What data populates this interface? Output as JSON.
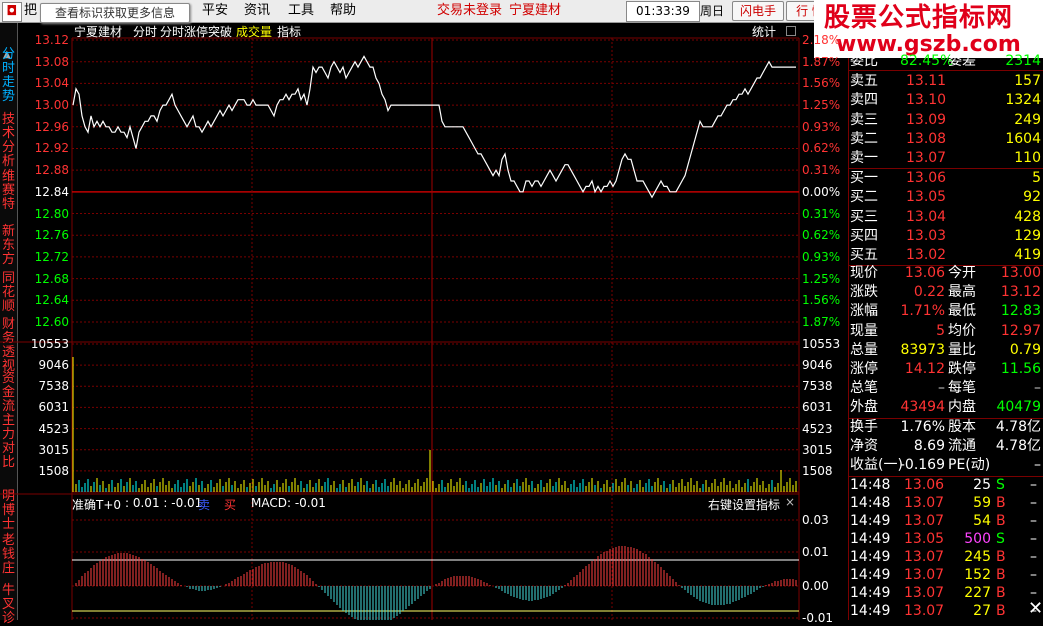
{
  "menubar": {
    "tip": "查看标识获取更多信息",
    "left_glyph": "把",
    "items": [
      "平安",
      "资讯",
      "工具",
      "帮助"
    ],
    "login_status": "交易未登录",
    "stock_name": "宁夏建材",
    "time": "01:33:39",
    "weekday": "周日",
    "flash_btn": "闪电手",
    "quote_btn": "行  情",
    "watermark": "股票公式指标网",
    "watermark_url": "www.gszb.com"
  },
  "sidebar": {
    "tabs": [
      "分时走势",
      "技术分析",
      "维赛特",
      "新东方",
      "同花顺",
      "财务透视",
      "资金流",
      "主力对比",
      "明博士",
      "老钱庄",
      "牛叉诊"
    ]
  },
  "chart_header": {
    "items": [
      "宁夏建材",
      "分时",
      "分时涨停突破",
      "成交量",
      "指标"
    ],
    "stats": "统计"
  },
  "macd_header": {
    "name": "准确T+0",
    "values": ": 0.01 : -0.01",
    "sell": "卖",
    "buy": "买",
    "macd": "MACD: -0.01",
    "right_text": "右键设置指标",
    "close": "×"
  },
  "chart_data": {
    "type": "line",
    "price_ticks_left": [
      "13.12",
      "13.08",
      "13.04",
      "13.00",
      "12.96",
      "12.92",
      "12.88",
      "12.84",
      "12.80",
      "12.76",
      "12.72",
      "12.68",
      "12.64",
      "12.60"
    ],
    "pct_ticks_right": [
      "2.18%",
      "1.87%",
      "1.56%",
      "1.25%",
      "0.93%",
      "0.62%",
      "0.31%",
      "0.00%",
      "0.31%",
      "0.62%",
      "0.93%",
      "1.25%",
      "1.56%",
      "1.87%"
    ],
    "volume_ticks": [
      "10553",
      "9046",
      "7538",
      "6031",
      "4523",
      "3015",
      "1508"
    ],
    "macd_ticks": [
      "0.03",
      "0.01",
      "0.00",
      "-0.01"
    ],
    "ylim": [
      12.58,
      13.14
    ],
    "prev_close": 12.84,
    "price_series": [
      13.0,
      13.03,
      13.02,
      12.98,
      12.96,
      12.95,
      12.98,
      12.96,
      12.97,
      12.96,
      12.97,
      12.96,
      12.96,
      12.95,
      12.95,
      12.96,
      12.95,
      12.95,
      12.94,
      12.96,
      12.94,
      12.92,
      12.95,
      12.96,
      12.97,
      12.97,
      12.98,
      12.98,
      12.97,
      12.99,
      13.0,
      13.0,
      13.01,
      13.02,
      13.0,
      12.99,
      12.98,
      12.97,
      12.96,
      12.97,
      12.98,
      12.96,
      12.96,
      12.95,
      12.96,
      12.97,
      12.96,
      12.97,
      12.98,
      12.99,
      12.98,
      12.99,
      13.0,
      12.99,
      13.0,
      13.01,
      13.01,
      13.01,
      13.0,
      13.0,
      13.01,
      13.0,
      13.0,
      13.0,
      13.0,
      13.0,
      12.99,
      12.98,
      13.0,
      13.01,
      13.01,
      13.02,
      13.01,
      13.02,
      13.02,
      13.03,
      13.01,
      13.02,
      13.0,
      13.03,
      13.07,
      13.06,
      13.07,
      13.07,
      13.06,
      13.05,
      13.07,
      13.08,
      13.07,
      13.06,
      13.07,
      13.05,
      13.06,
      13.07,
      13.08,
      13.07,
      13.08,
      13.09,
      13.08,
      13.07,
      13.07,
      13.05,
      13.04,
      13.02,
      13.01,
      12.99,
      13.0,
      13.0,
      13.0,
      13.0,
      13.0,
      13.0,
      13.0,
      13.0,
      13.0,
      13.0,
      13.0,
      13.0,
      13.0,
      13.0,
      13.0,
      13.0,
      13.0,
      12.97,
      12.96,
      12.96,
      12.96,
      12.96,
      12.96,
      12.96,
      12.96,
      12.95,
      12.94,
      12.93,
      12.92,
      12.91,
      12.91,
      12.9,
      12.89,
      12.88,
      12.87,
      12.88,
      12.87,
      12.9,
      12.91,
      12.88,
      12.86,
      12.86,
      12.85,
      12.84,
      12.84,
      12.86,
      12.86,
      12.85,
      12.86,
      12.86,
      12.85,
      12.86,
      12.87,
      12.88,
      12.87,
      12.86,
      12.87,
      12.88,
      12.89,
      12.89,
      12.88,
      12.87,
      12.86,
      12.85,
      12.84,
      12.85,
      12.85,
      12.86,
      12.84,
      12.85,
      12.84,
      12.85,
      12.85,
      12.86,
      12.85,
      12.86,
      12.88,
      12.9,
      12.91,
      12.9,
      12.9,
      12.88,
      12.86,
      12.86,
      12.86,
      12.85,
      12.84,
      12.83,
      12.84,
      12.85,
      12.86,
      12.85,
      12.85,
      12.84,
      12.84,
      12.84,
      12.85,
      12.86,
      12.87,
      12.89,
      12.91,
      12.93,
      12.95,
      12.97,
      12.96,
      12.96,
      12.96,
      12.96,
      12.97,
      12.98,
      12.98,
      12.99,
      13.0,
      13.0,
      13.01,
      13.01,
      13.02,
      13.02,
      13.03,
      13.02,
      13.03,
      13.04,
      13.05,
      13.05,
      13.06,
      13.07,
      13.08,
      13.07,
      13.07,
      13.07,
      13.07,
      13.07,
      13.07,
      13.07,
      13.07,
      13.07
    ]
  },
  "quotes": {
    "ratio_label": "委比",
    "ratio_value": "82.45%",
    "diff_label": "委差",
    "diff_value": "2314",
    "asks": [
      {
        "label": "卖五",
        "price": "13.11",
        "vol": "157"
      },
      {
        "label": "卖四",
        "price": "13.10",
        "vol": "1324"
      },
      {
        "label": "卖三",
        "price": "13.09",
        "vol": "249"
      },
      {
        "label": "卖二",
        "price": "13.08",
        "vol": "1604"
      },
      {
        "label": "卖一",
        "price": "13.07",
        "vol": "110"
      }
    ],
    "bids": [
      {
        "label": "买一",
        "price": "13.06",
        "vol": "5"
      },
      {
        "label": "买二",
        "price": "13.05",
        "vol": "92"
      },
      {
        "label": "买三",
        "price": "13.04",
        "vol": "428"
      },
      {
        "label": "买四",
        "price": "13.03",
        "vol": "129"
      },
      {
        "label": "买五",
        "price": "13.02",
        "vol": "419"
      }
    ],
    "stats": [
      {
        "l1": "现价",
        "v1": "13.06",
        "c1": "red",
        "l2": "今开",
        "v2": "13.00",
        "c2": "red"
      },
      {
        "l1": "涨跌",
        "v1": "0.22",
        "c1": "red",
        "l2": "最高",
        "v2": "13.12",
        "c2": "red"
      },
      {
        "l1": "涨幅",
        "v1": "1.71%",
        "c1": "red",
        "l2": "最低",
        "v2": "12.83",
        "c2": "green"
      },
      {
        "l1": "现量",
        "v1": "5",
        "c1": "red",
        "l2": "均价",
        "v2": "12.97",
        "c2": "red"
      },
      {
        "l1": "总量",
        "v1": "83973",
        "c1": "yellow",
        "l2": "量比",
        "v2": "0.79",
        "c2": "yellow"
      },
      {
        "l1": "涨停",
        "v1": "14.12",
        "c1": "red",
        "l2": "跌停",
        "v2": "11.56",
        "c2": "green"
      },
      {
        "l1": "总笔",
        "v1": "–",
        "c1": "gray",
        "l2": "每笔",
        "v2": "–",
        "c2": "gray"
      },
      {
        "l1": "外盘",
        "v1": "43494",
        "c1": "red",
        "l2": "内盘",
        "v2": "40479",
        "c2": "green"
      }
    ],
    "stats2": [
      {
        "l1": "换手",
        "v1": "1.76%",
        "l2": "股本",
        "v2": "4.78亿"
      },
      {
        "l1": "净资",
        "v1": "8.69",
        "l2": "流通",
        "v2": "4.78亿"
      },
      {
        "l1": "收益(一)",
        "v1": "-0.169",
        "l2": "PE(动)",
        "v2": "–"
      }
    ],
    "ticks": [
      {
        "time": "14:48",
        "price": "13.06",
        "vol": "25",
        "side": "S",
        "vc": "white",
        "sc": "green"
      },
      {
        "time": "14:48",
        "price": "13.07",
        "vol": "59",
        "side": "B",
        "vc": "yellow",
        "sc": "red"
      },
      {
        "time": "14:49",
        "price": "13.07",
        "vol": "54",
        "side": "B",
        "vc": "yellow",
        "sc": "red"
      },
      {
        "time": "14:49",
        "price": "13.05",
        "vol": "500",
        "side": "S",
        "vc": "purple",
        "sc": "green"
      },
      {
        "time": "14:49",
        "price": "13.07",
        "vol": "245",
        "side": "B",
        "vc": "yellow",
        "sc": "red"
      },
      {
        "time": "14:49",
        "price": "13.07",
        "vol": "152",
        "side": "B",
        "vc": "yellow",
        "sc": "red"
      },
      {
        "time": "14:49",
        "price": "13.07",
        "vol": "227",
        "side": "B",
        "vc": "yellow",
        "sc": "red"
      },
      {
        "time": "14:49",
        "price": "13.07",
        "vol": "27",
        "side": "B",
        "vc": "yellow",
        "sc": "red"
      }
    ],
    "tick_dash": "–"
  }
}
